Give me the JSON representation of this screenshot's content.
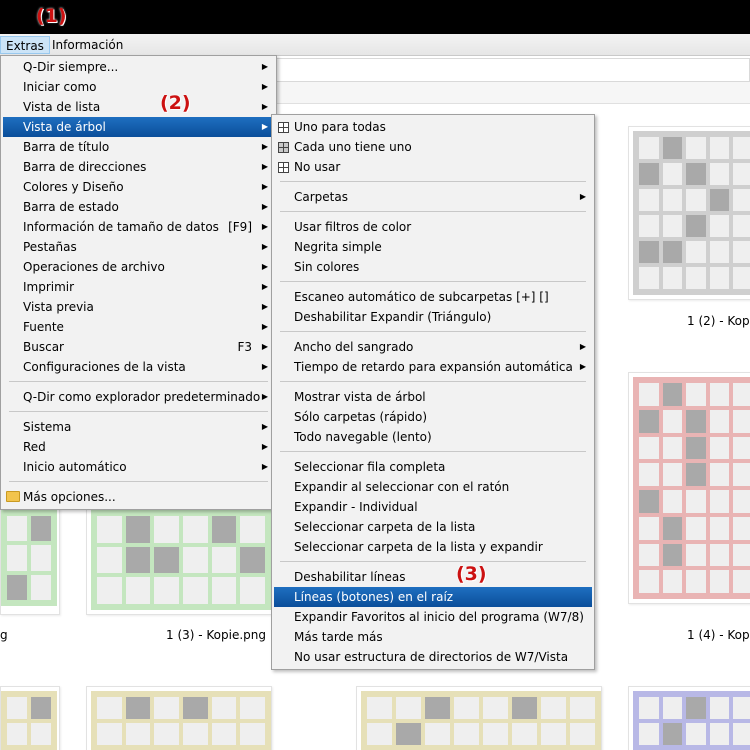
{
  "menubar": {
    "extras": "Extras",
    "informacion": "Información"
  },
  "callouts": {
    "c1": "(1)",
    "c2": "(2)",
    "c3": "(3)"
  },
  "captions": {
    "a": "1 (2) - Kopie",
    "b": "1 (3) - Kopie.png",
    "c": "1 (4) - Kopie",
    "d": "g"
  },
  "extras_menu": {
    "items": [
      {
        "label": "Q-Dir siempre...",
        "arrow": true
      },
      {
        "label": "Iniciar como",
        "arrow": true
      },
      {
        "label": "Vista de lista",
        "arrow": true
      },
      {
        "label": "Vista de árbol",
        "arrow": true,
        "highlighted": true
      },
      {
        "label": "Barra de título",
        "arrow": true
      },
      {
        "label": "Barra de direcciones",
        "arrow": true
      },
      {
        "label": "Colores y Diseño",
        "arrow": true
      },
      {
        "label": "Barra de estado",
        "arrow": true
      },
      {
        "label": "Información de tamaño de datos",
        "shortcut": "[F9]",
        "arrow": true
      },
      {
        "label": "Pestañas",
        "arrow": true
      },
      {
        "label": "Operaciones de archivo",
        "arrow": true
      },
      {
        "label": "Imprimir",
        "arrow": true
      },
      {
        "label": "Vista previa",
        "arrow": true
      },
      {
        "label": "Fuente",
        "arrow": true
      },
      {
        "label": "Buscar",
        "shortcut": "F3",
        "arrow": true
      },
      {
        "label": "Configuraciones de la vista",
        "arrow": true
      },
      {
        "label": "Q-Dir como explorador predeterminado",
        "arrow": true
      },
      {
        "label": "Sistema",
        "arrow": true
      },
      {
        "label": "Red",
        "arrow": true
      },
      {
        "label": "Inicio automático",
        "arrow": true
      },
      {
        "label": "Más opciones...",
        "icon": "folder-icon"
      }
    ]
  },
  "tree_menu": {
    "items": [
      {
        "label": "Uno para todas",
        "icon": "grid-icon"
      },
      {
        "label": "Cada uno tiene uno",
        "icon": "grid-filled-icon"
      },
      {
        "label": "No usar",
        "icon": "grid-icon"
      },
      {
        "label": "Carpetas",
        "arrow": true
      },
      {
        "label": "Usar filtros de color"
      },
      {
        "label": "Negrita simple"
      },
      {
        "label": "Sin colores"
      },
      {
        "label": "Escaneo automático de subcarpetas [+] []"
      },
      {
        "label": "Deshabilitar Expandir (Triángulo)"
      },
      {
        "label": "Ancho del sangrado",
        "arrow": true
      },
      {
        "label": "Tiempo de retardo para expansión automática",
        "arrow": true
      },
      {
        "label": "Mostrar vista de árbol"
      },
      {
        "label": "Sólo carpetas (rápido)"
      },
      {
        "label": "Todo navegable (lento)"
      },
      {
        "label": "Seleccionar fila completa"
      },
      {
        "label": "Expandir al seleccionar con el ratón"
      },
      {
        "label": "Expandir - Individual"
      },
      {
        "label": "Seleccionar carpeta de la lista"
      },
      {
        "label": "Seleccionar carpeta de la lista y expandir"
      },
      {
        "label": "Deshabilitar líneas"
      },
      {
        "label": "Líneas (botones) en el raíz",
        "highlighted": true
      },
      {
        "label": "Expandir Favoritos al inicio del programa (W7/8)"
      },
      {
        "label": "Más tarde más"
      },
      {
        "label": "No usar estructura de directorios de W7/Vista"
      }
    ]
  },
  "colors": {
    "highlight": "#0b4e9a",
    "callout": "#cc1111",
    "thumb_gray": "#cfcfcf",
    "thumb_red": "#e9b4b4",
    "thumb_green": "#c4e6bf",
    "thumb_yellow": "#e6e0b8",
    "thumb_blue": "#b8b8e6"
  }
}
